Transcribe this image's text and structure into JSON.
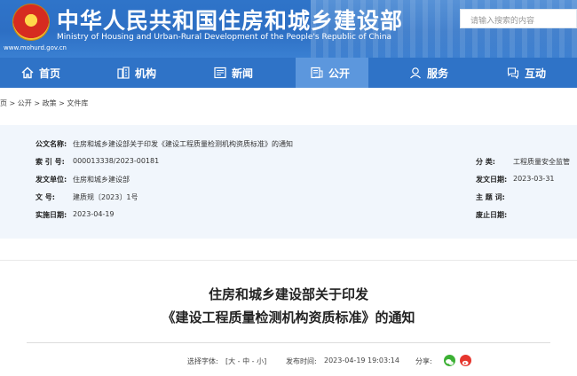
{
  "header": {
    "title": "中华人民共和国住房和城乡建设部",
    "subtitle": "Ministry of Housing and Urban-Rural Development of the People's Republic of China",
    "url": "www.mohurd.gov.cn",
    "search_placeholder": "请输入搜索的内容"
  },
  "nav": {
    "items": [
      {
        "label": "首页",
        "icon": "home-icon"
      },
      {
        "label": "机构",
        "icon": "org-icon"
      },
      {
        "label": "新闻",
        "icon": "news-icon"
      },
      {
        "label": "公开",
        "icon": "open-icon",
        "active": true
      },
      {
        "label": "服务",
        "icon": "service-icon"
      },
      {
        "label": "互动",
        "icon": "interact-icon"
      }
    ]
  },
  "breadcrumb": "页 > 公开 > 政策 > 文件库",
  "info": {
    "title_label": "公文名称:",
    "title_value": "住房和城乡建设部关于印发《建设工程质量检测机构资质标准》的通知",
    "index_label": "索 引 号:",
    "index_value": "000013338/2023-00181",
    "category_label": "分    类:",
    "category_value": "工程质量安全监管",
    "issuer_label": "发文单位:",
    "issuer_value": "住房和城乡建设部",
    "issue_date_label": "发文日期:",
    "issue_date_value": "2023-03-31",
    "doc_no_label": "文    号:",
    "doc_no_value": "建质规〔2023〕1号",
    "subject_label": "主 题 词:",
    "subject_value": "",
    "impl_date_label": "实施日期:",
    "impl_date_value": "2023-04-19",
    "expiry_label": "废止日期:",
    "expiry_value": ""
  },
  "article": {
    "title_line1": "住房和城乡建设部关于印发",
    "title_line2": "《建设工程质量检测机构资质标准》的通知",
    "font_label": "选择字体:",
    "font_options": "[大 - 中 - 小]",
    "publish_label": "发布时间:",
    "publish_time": "2023-04-19 19:03:14",
    "share_label": "分享:"
  },
  "colors": {
    "primary": "#2f73c7",
    "nav_active": "#5c97dd",
    "info_bg": "#f1f6fc",
    "wechat": "#3cb034",
    "weibo": "#e6362e"
  }
}
